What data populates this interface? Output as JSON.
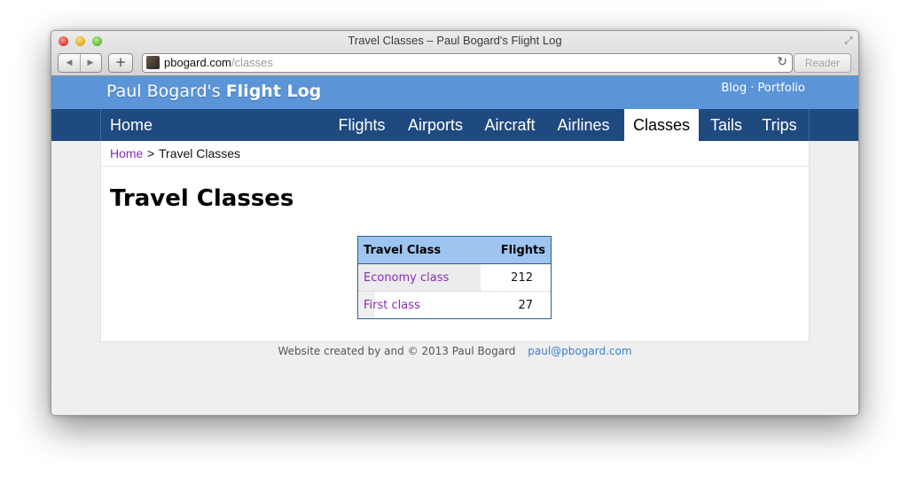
{
  "window": {
    "title": "Travel Classes – Paul Bogard's Flight Log"
  },
  "toolbar": {
    "back_icon": "◀",
    "forward_icon": "▶",
    "add_icon": "+",
    "url_domain": "pbogard.com",
    "url_path": "/classes",
    "reload_icon": "↻",
    "reader_label": "Reader"
  },
  "site": {
    "brand_light": "Paul Bogard's",
    "brand_bold": "Flight Log",
    "toplinks": {
      "blog": "Blog",
      "separator": "·",
      "portfolio": "Portfolio"
    }
  },
  "nav": {
    "home": "Home",
    "items": [
      "Flights",
      "Airports",
      "Aircraft",
      "Airlines",
      "Classes",
      "Tails",
      "Trips"
    ],
    "active": "Classes"
  },
  "breadcrumb": {
    "home": "Home",
    "separator": ">",
    "current": "Travel Classes"
  },
  "page": {
    "title": "Travel Classes"
  },
  "table": {
    "headers": [
      "Travel Class",
      "Flights"
    ],
    "rows": [
      {
        "class": "Economy class",
        "flights": "212"
      },
      {
        "class": "First class",
        "flights": "27"
      }
    ]
  },
  "footer": {
    "text": "Website created by and © 2013 Paul Bogard",
    "email": "paul@pbogard.com"
  },
  "colors": {
    "header_blue": "#5b95d8",
    "nav_blue": "#1f4a80",
    "link_purple": "#8a2bb3",
    "table_header": "#9ec4f0"
  }
}
